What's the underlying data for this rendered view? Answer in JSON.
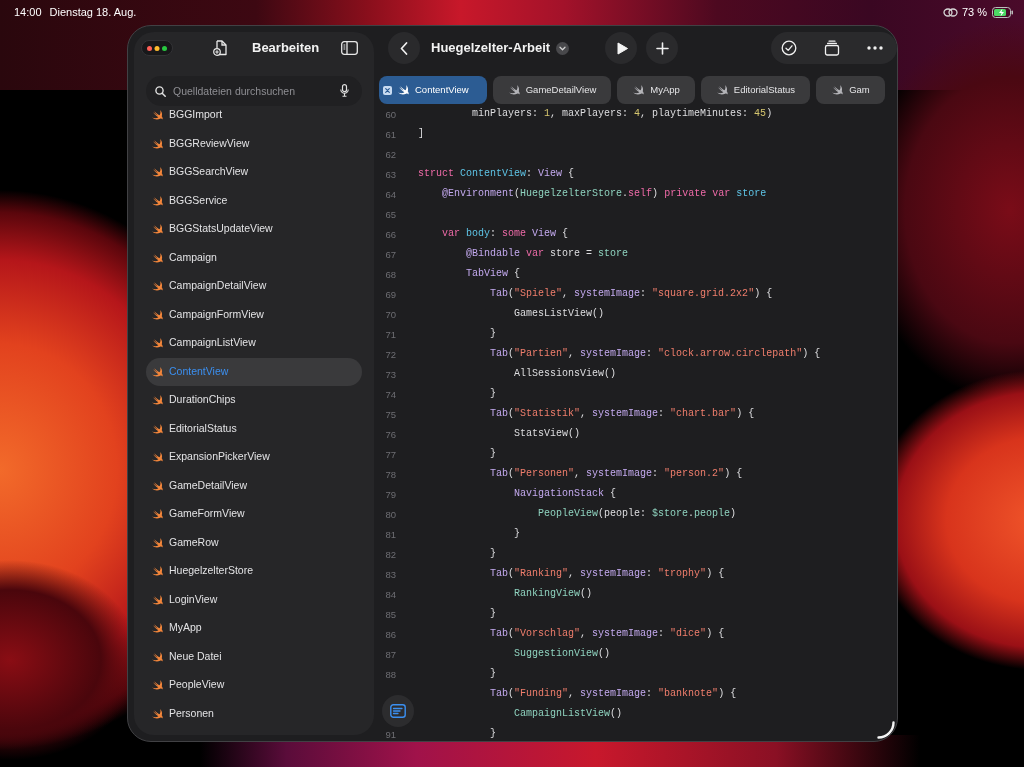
{
  "status_bar": {
    "time": "14:00",
    "date": "Dienstag 18. Aug.",
    "battery": "73 %"
  },
  "sidebar": {
    "title": "Bearbeiten",
    "search": {
      "placeholder": "Quelldateien durchsuchen"
    },
    "files": [
      {
        "name": "BGGImport",
        "selected": false
      },
      {
        "name": "BGGReviewView",
        "selected": false
      },
      {
        "name": "BGGSearchView",
        "selected": false
      },
      {
        "name": "BGGService",
        "selected": false
      },
      {
        "name": "BGGStatsUpdateView",
        "selected": false
      },
      {
        "name": "Campaign",
        "selected": false
      },
      {
        "name": "CampaignDetailView",
        "selected": false
      },
      {
        "name": "CampaignFormView",
        "selected": false
      },
      {
        "name": "CampaignListView",
        "selected": false
      },
      {
        "name": "ContentView",
        "selected": true
      },
      {
        "name": "DurationChips",
        "selected": false
      },
      {
        "name": "EditorialStatus",
        "selected": false
      },
      {
        "name": "ExpansionPickerView",
        "selected": false
      },
      {
        "name": "GameDetailView",
        "selected": false
      },
      {
        "name": "GameFormView",
        "selected": false
      },
      {
        "name": "GameRow",
        "selected": false
      },
      {
        "name": "HuegelzelterStore",
        "selected": false
      },
      {
        "name": "LoginView",
        "selected": false
      },
      {
        "name": "MyApp",
        "selected": false
      },
      {
        "name": "Neue Datei",
        "selected": false
      },
      {
        "name": "PeopleView",
        "selected": false
      },
      {
        "name": "Personen",
        "selected": false
      }
    ]
  },
  "editor": {
    "title": "Huegelzelter-Arbeit",
    "tabs": [
      {
        "label": "ContentView",
        "selected": true
      },
      {
        "label": "GameDetailView",
        "selected": false
      },
      {
        "label": "MyApp",
        "selected": false
      },
      {
        "label": "EditorialStatus",
        "selected": false
      },
      {
        "label": "Gam",
        "selected": false
      }
    ],
    "lines": [
      {
        "number": "60",
        "tokens": [
          {
            "kind": "plain",
            "text": "         minPlayers: "
          },
          {
            "kind": "number",
            "text": "1"
          },
          {
            "kind": "plain",
            "text": ", maxPlayers: "
          },
          {
            "kind": "number",
            "text": "4"
          },
          {
            "kind": "plain",
            "text": ", playtimeMinutes: "
          },
          {
            "kind": "number",
            "text": "45"
          },
          {
            "kind": "plain",
            "text": ")"
          }
        ]
      },
      {
        "number": "61",
        "tokens": [
          {
            "kind": "plain",
            "text": "]"
          }
        ]
      },
      {
        "number": "62"
      },
      {
        "number": "63",
        "tokens": [
          {
            "kind": "keyword",
            "text": "struct "
          },
          {
            "kind": "declaration",
            "text": "ContentView"
          },
          {
            "kind": "plain",
            "text": ": "
          },
          {
            "kind": "type",
            "text": "View"
          },
          {
            "kind": "plain",
            "text": " {"
          }
        ]
      },
      {
        "number": "64",
        "tokens": [
          {
            "kind": "type",
            "text": "    @Environment"
          },
          {
            "kind": "plain",
            "text": "("
          },
          {
            "kind": "project",
            "text": "HuegelzelterStore"
          },
          {
            "kind": "plain",
            "text": "."
          },
          {
            "kind": "keyword",
            "text": "self"
          },
          {
            "kind": "plain",
            "text": ") "
          },
          {
            "kind": "keyword",
            "text": "private var "
          },
          {
            "kind": "declaration",
            "text": "store"
          }
        ]
      },
      {
        "number": "65"
      },
      {
        "number": "66",
        "tokens": [
          {
            "kind": "keyword",
            "text": "    var "
          },
          {
            "kind": "declaration",
            "text": "body"
          },
          {
            "kind": "plain",
            "text": ": "
          },
          {
            "kind": "keyword",
            "text": "some "
          },
          {
            "kind": "type",
            "text": "View"
          },
          {
            "kind": "plain",
            "text": " {"
          }
        ]
      },
      {
        "number": "67",
        "tokens": [
          {
            "kind": "type",
            "text": "        @Bindable "
          },
          {
            "kind": "keyword",
            "text": "var"
          },
          {
            "kind": "plain",
            "text": " store = "
          },
          {
            "kind": "project",
            "text": "store"
          }
        ]
      },
      {
        "number": "68",
        "tokens": [
          {
            "kind": "type",
            "text": "        TabView"
          },
          {
            "kind": "plain",
            "text": " {"
          }
        ]
      },
      {
        "number": "69",
        "tokens": [
          {
            "kind": "type",
            "text": "            Tab"
          },
          {
            "kind": "plain",
            "text": "("
          },
          {
            "kind": "string",
            "text": "\"Spiele\""
          },
          {
            "kind": "plain",
            "text": ", "
          },
          {
            "kind": "type",
            "text": "systemImage"
          },
          {
            "kind": "plain",
            "text": ": "
          },
          {
            "kind": "string",
            "text": "\"square.grid.2x2\""
          },
          {
            "kind": "plain",
            "text": ") {"
          }
        ]
      },
      {
        "number": "70",
        "tokens": [
          {
            "kind": "plain",
            "text": "                GamesListView()"
          }
        ]
      },
      {
        "number": "71",
        "tokens": [
          {
            "kind": "plain",
            "text": "            }"
          }
        ]
      },
      {
        "number": "72",
        "tokens": [
          {
            "kind": "type",
            "text": "            Tab"
          },
          {
            "kind": "plain",
            "text": "("
          },
          {
            "kind": "string",
            "text": "\"Partien\""
          },
          {
            "kind": "plain",
            "text": ", "
          },
          {
            "kind": "type",
            "text": "systemImage"
          },
          {
            "kind": "plain",
            "text": ": "
          },
          {
            "kind": "string",
            "text": "\"clock.arrow.circlepath\""
          },
          {
            "kind": "plain",
            "text": ") {"
          }
        ]
      },
      {
        "number": "73",
        "tokens": [
          {
            "kind": "plain",
            "text": "                AllSessionsView()"
          }
        ]
      },
      {
        "number": "74",
        "tokens": [
          {
            "kind": "plain",
            "text": "            }"
          }
        ]
      },
      {
        "number": "75",
        "tokens": [
          {
            "kind": "type",
            "text": "            Tab"
          },
          {
            "kind": "plain",
            "text": "("
          },
          {
            "kind": "string",
            "text": "\"Statistik\""
          },
          {
            "kind": "plain",
            "text": ", "
          },
          {
            "kind": "type",
            "text": "systemImage"
          },
          {
            "kind": "plain",
            "text": ": "
          },
          {
            "kind": "string",
            "text": "\"chart.bar\""
          },
          {
            "kind": "plain",
            "text": ") {"
          }
        ]
      },
      {
        "number": "76",
        "tokens": [
          {
            "kind": "plain",
            "text": "                StatsView()"
          }
        ]
      },
      {
        "number": "77",
        "tokens": [
          {
            "kind": "plain",
            "text": "            }"
          }
        ]
      },
      {
        "number": "78",
        "tokens": [
          {
            "kind": "type",
            "text": "            Tab"
          },
          {
            "kind": "plain",
            "text": "("
          },
          {
            "kind": "string",
            "text": "\"Personen\""
          },
          {
            "kind": "plain",
            "text": ", "
          },
          {
            "kind": "type",
            "text": "systemImage"
          },
          {
            "kind": "plain",
            "text": ": "
          },
          {
            "kind": "string",
            "text": "\"person.2\""
          },
          {
            "kind": "plain",
            "text": ") {"
          }
        ]
      },
      {
        "number": "79",
        "tokens": [
          {
            "kind": "type",
            "text": "                NavigationStack"
          },
          {
            "kind": "plain",
            "text": " {"
          }
        ]
      },
      {
        "number": "80",
        "tokens": [
          {
            "kind": "project",
            "text": "                    PeopleView"
          },
          {
            "kind": "plain",
            "text": "(people: "
          },
          {
            "kind": "project",
            "text": "$store"
          },
          {
            "kind": "plain",
            "text": "."
          },
          {
            "kind": "project",
            "text": "people"
          },
          {
            "kind": "plain",
            "text": ")"
          }
        ]
      },
      {
        "number": "81",
        "tokens": [
          {
            "kind": "plain",
            "text": "                }"
          }
        ]
      },
      {
        "number": "82",
        "tokens": [
          {
            "kind": "plain",
            "text": "            }"
          }
        ]
      },
      {
        "number": "83",
        "tokens": [
          {
            "kind": "type",
            "text": "            Tab"
          },
          {
            "kind": "plain",
            "text": "("
          },
          {
            "kind": "string",
            "text": "\"Ranking\""
          },
          {
            "kind": "plain",
            "text": ", "
          },
          {
            "kind": "type",
            "text": "systemImage"
          },
          {
            "kind": "plain",
            "text": ": "
          },
          {
            "kind": "string",
            "text": "\"trophy\""
          },
          {
            "kind": "plain",
            "text": ") {"
          }
        ]
      },
      {
        "number": "84",
        "tokens": [
          {
            "kind": "project",
            "text": "                RankingView"
          },
          {
            "kind": "plain",
            "text": "()"
          }
        ]
      },
      {
        "number": "85",
        "tokens": [
          {
            "kind": "plain",
            "text": "            }"
          }
        ]
      },
      {
        "number": "86",
        "tokens": [
          {
            "kind": "type",
            "text": "            Tab"
          },
          {
            "kind": "plain",
            "text": "("
          },
          {
            "kind": "string",
            "text": "\"Vorschlag\""
          },
          {
            "kind": "plain",
            "text": ", "
          },
          {
            "kind": "type",
            "text": "systemImage"
          },
          {
            "kind": "plain",
            "text": ": "
          },
          {
            "kind": "string",
            "text": "\"dice\""
          },
          {
            "kind": "plain",
            "text": ") {"
          }
        ]
      },
      {
        "number": "87",
        "tokens": [
          {
            "kind": "project",
            "text": "                SuggestionView"
          },
          {
            "kind": "plain",
            "text": "()"
          }
        ]
      },
      {
        "number": "88",
        "tokens": [
          {
            "kind": "plain",
            "text": "            }"
          }
        ]
      },
      {
        "tokens": [
          {
            "kind": "type",
            "text": "            Tab"
          },
          {
            "kind": "plain",
            "text": "("
          },
          {
            "kind": "string",
            "text": "\"Funding\""
          },
          {
            "kind": "plain",
            "text": ", "
          },
          {
            "kind": "type",
            "text": "systemImage"
          },
          {
            "kind": "plain",
            "text": ": "
          },
          {
            "kind": "string",
            "text": "\"banknote\""
          },
          {
            "kind": "plain",
            "text": ") {"
          }
        ]
      },
      {
        "tokens": [
          {
            "kind": "project",
            "text": "                CampaignListView"
          },
          {
            "kind": "plain",
            "text": "()"
          }
        ]
      },
      {
        "number": "91",
        "tokens": [
          {
            "kind": "plain",
            "text": "            }"
          }
        ]
      }
    ]
  }
}
